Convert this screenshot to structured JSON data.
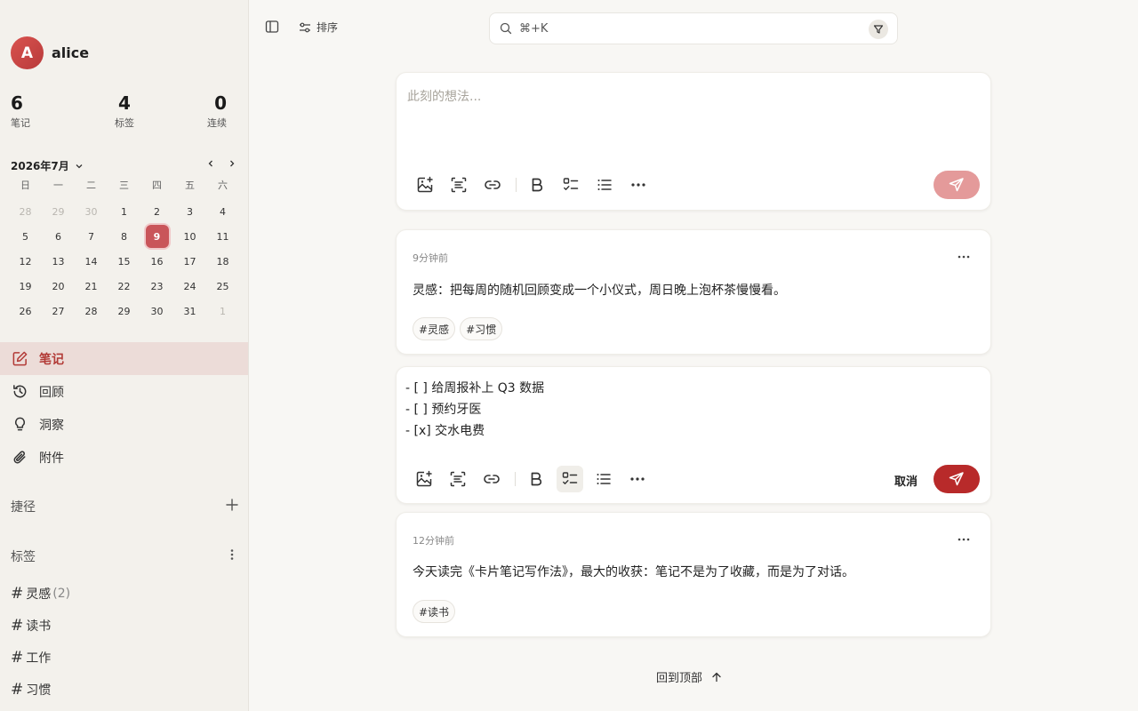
{
  "user": {
    "initial": "A",
    "name": "alice"
  },
  "stats": [
    {
      "value": "6",
      "label": "笔记"
    },
    {
      "value": "4",
      "label": "标签"
    },
    {
      "value": "0",
      "label": "连续"
    }
  ],
  "calendar": {
    "title": "2026年7月",
    "weekdays": [
      "日",
      "一",
      "二",
      "三",
      "四",
      "五",
      "六"
    ],
    "today": "9",
    "weeks": [
      [
        "28",
        "29",
        "30",
        "1",
        "2",
        "3",
        "4"
      ],
      [
        "5",
        "6",
        "7",
        "8",
        "9",
        "10",
        "11"
      ],
      [
        "12",
        "13",
        "14",
        "15",
        "16",
        "17",
        "18"
      ],
      [
        "19",
        "20",
        "21",
        "22",
        "23",
        "24",
        "25"
      ],
      [
        "26",
        "27",
        "28",
        "29",
        "30",
        "31",
        "1"
      ]
    ]
  },
  "nav": {
    "notes": "笔记",
    "review": "回顾",
    "insights": "洞察",
    "attachments": "附件"
  },
  "shortcuts": {
    "title": "捷径"
  },
  "tags_section": {
    "title": "标签",
    "items": [
      {
        "name": "灵感",
        "count": "(2)"
      },
      {
        "name": "读书",
        "count": ""
      },
      {
        "name": "工作",
        "count": ""
      },
      {
        "name": "习惯",
        "count": ""
      }
    ]
  },
  "topbar": {
    "sort_label": "排序",
    "search_placeholder": "⌘+K"
  },
  "composer": {
    "placeholder": "此刻的想法..."
  },
  "notes": [
    {
      "time": "9分钟前",
      "text": "灵感：把每周的随机回顾变成一个小仪式，周日晚上泡杯茶慢慢看。",
      "tags": [
        "#灵感",
        "#习惯"
      ]
    },
    {
      "time": "12分钟前",
      "text": "今天读完《卡片笔记写作法》，最大的收获：笔记不是为了收藏，而是为了对话。",
      "tags": [
        "#读书"
      ]
    }
  ],
  "editing": {
    "lines": [
      "- [ ] 给周报补上 Q3 数据",
      "- [ ] 预约牙医",
      "- [x] 交水电费"
    ],
    "cancel_label": "取消"
  },
  "back_to_top": "回到顶部",
  "colors": {
    "accent": "#b82a2a",
    "accent_light": "#e49a9a",
    "active_nav_bg": "#ecdcd8",
    "today_bg": "#c9555a"
  }
}
